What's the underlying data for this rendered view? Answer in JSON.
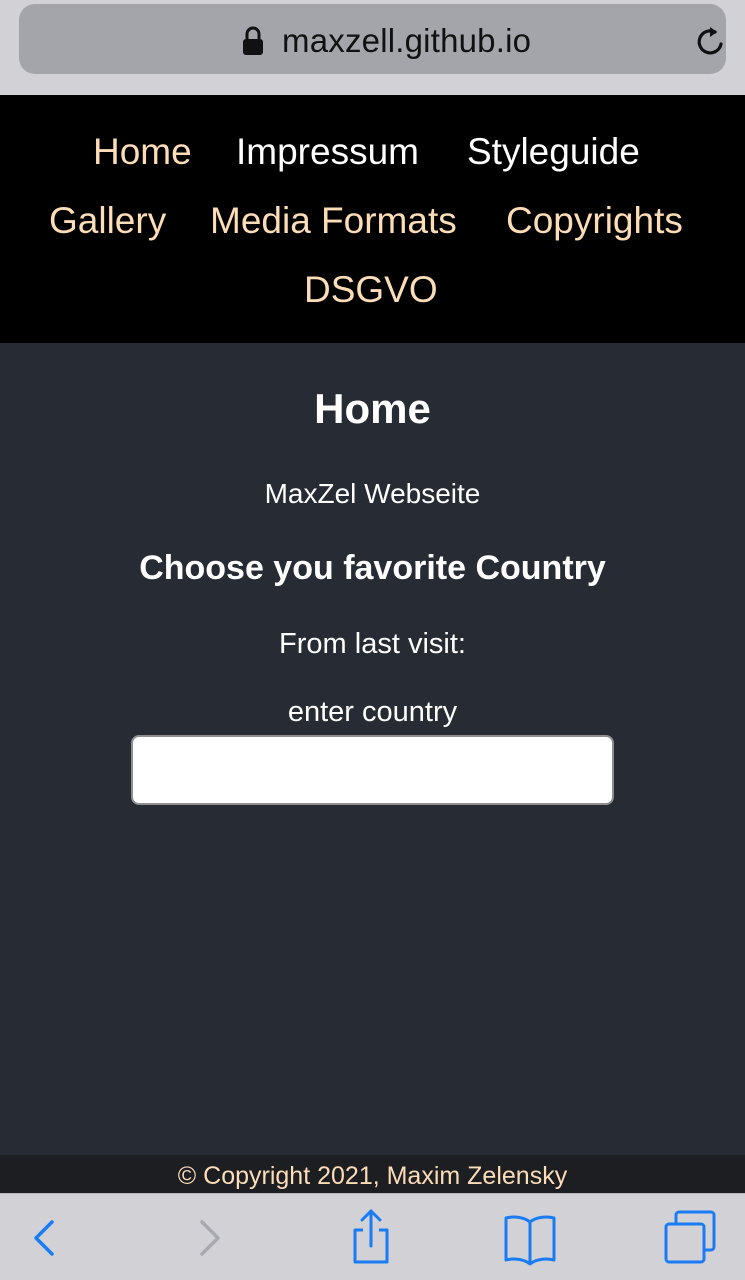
{
  "browser": {
    "url": "maxzell.github.io",
    "lock_icon": "lock-icon",
    "reload_icon": "reload-icon"
  },
  "nav": {
    "items": [
      {
        "label": "Home",
        "active": true
      },
      {
        "label": "Impressum",
        "active": false
      },
      {
        "label": "Styleguide",
        "active": false
      },
      {
        "label": "Gallery",
        "active": true
      },
      {
        "label": "Media Formats",
        "active": true
      },
      {
        "label": "Copyrights",
        "active": true
      },
      {
        "label": "DSGVO",
        "active": true
      }
    ]
  },
  "main": {
    "title": "Home",
    "subtitle": "MaxZel Webseite",
    "section_title": "Choose you favorite Country",
    "last_visit_label": "From last visit:",
    "enter_label": "enter country",
    "country_input_value": ""
  },
  "footer": {
    "copyright": "© Copyright 2021, Maxim Zelensky"
  },
  "toolbar": {
    "back_icon": "chevron-left-icon",
    "forward_icon": "chevron-right-icon",
    "share_icon": "share-icon",
    "bookmarks_icon": "book-icon",
    "tabs_icon": "tabs-icon"
  },
  "colors": {
    "accent_link": "#fddcb8",
    "page_bg": "#272b33",
    "nav_bg": "#000000",
    "toolbar_blue": "#1a7cf5"
  }
}
